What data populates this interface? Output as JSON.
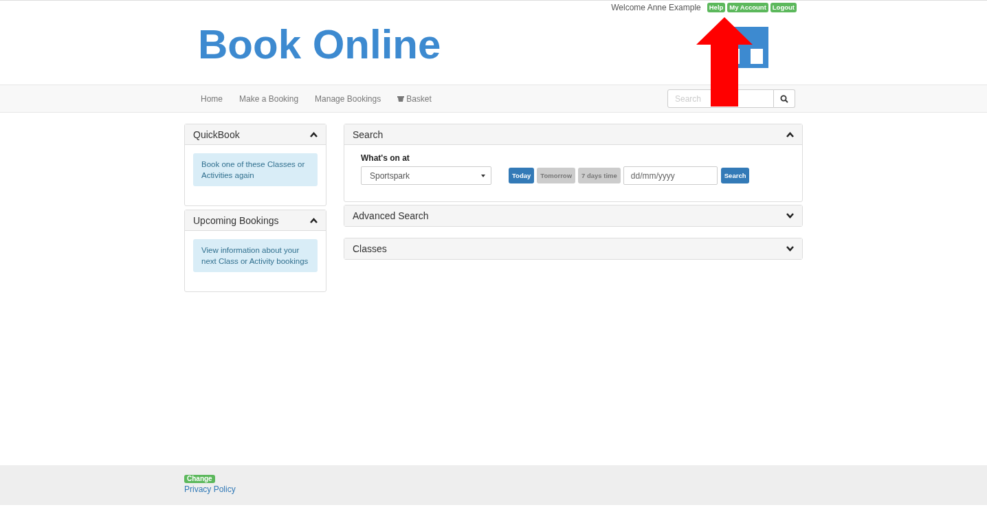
{
  "top_bar": {
    "welcome": "Welcome Anne Example",
    "links": [
      "Help",
      "My Account",
      "Logout"
    ]
  },
  "logo": "Book Online",
  "nav": {
    "items": [
      {
        "label": "Home",
        "kind": "text"
      },
      {
        "label": "Make a Booking",
        "kind": "text"
      },
      {
        "label": "Manage Bookings",
        "kind": "text"
      },
      {
        "label": "Basket",
        "kind": "basket"
      }
    ],
    "search": {
      "placeholder": "Search"
    }
  },
  "sidebar": [
    {
      "title": "QuickBook",
      "expanded": true,
      "text": "Book one of these Classes or Activities again"
    },
    {
      "title": "Upcoming Bookings",
      "expanded": true,
      "text": "View information about your next Class or Activity bookings"
    }
  ],
  "panels": [
    {
      "title": "Search",
      "expanded": true
    },
    {
      "title": "Advanced Search",
      "expanded": false
    },
    {
      "title": "Classes",
      "expanded": false
    }
  ],
  "search_form": {
    "label": "What's on at",
    "venue": "Sportspark",
    "days": [
      {
        "label": "Today",
        "selected": true
      },
      {
        "label": "Tomorrow",
        "selected": false
      },
      {
        "label": "7 days time",
        "selected": false
      }
    ],
    "date_placeholder": "dd/mm/yyyy",
    "button": "Search"
  },
  "footer": {
    "badge": "Change",
    "link": "Privacy Policy"
  }
}
